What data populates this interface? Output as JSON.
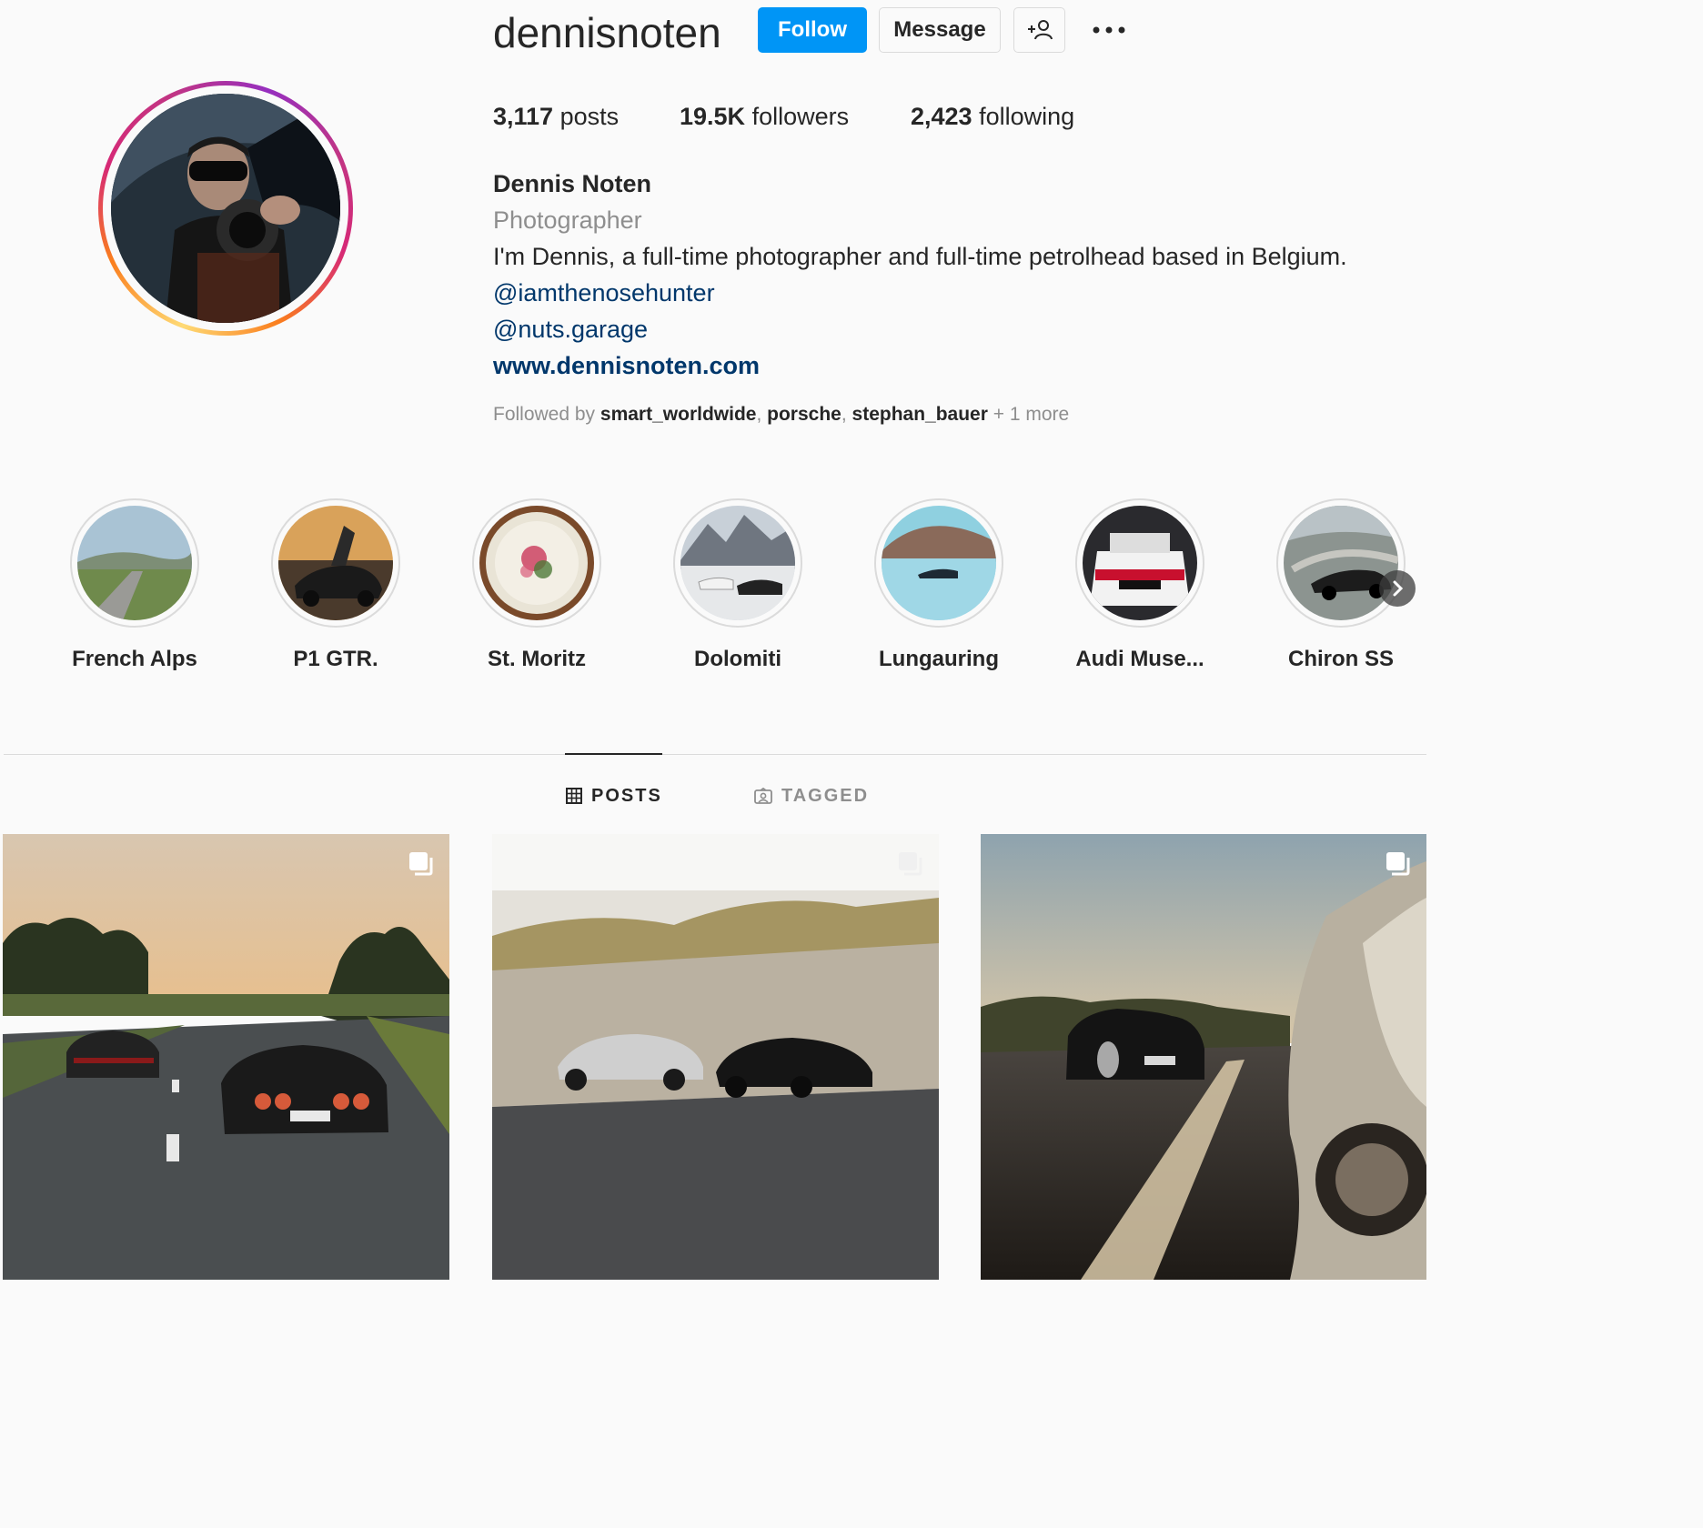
{
  "profile": {
    "username": "dennisnoten",
    "follow_label": "Follow",
    "message_label": "Message",
    "stats": {
      "posts_value": "3,117",
      "posts_label": "posts",
      "followers_value": "19.5K",
      "followers_label": "followers",
      "following_value": "2,423",
      "following_label": "following"
    },
    "full_name": "Dennis Noten",
    "category": "Photographer",
    "bio": "I'm Dennis, a full-time photographer and full-time petrolhead based in Belgium.",
    "mentions": [
      "@iamthenosehunter",
      "@nuts.garage"
    ],
    "website": "www.dennisnoten.com",
    "followed_by": {
      "prefix": "Followed by",
      "accounts": [
        "smart_worldwide",
        "porsche",
        "stephan_bauer"
      ],
      "suffix": "+ 1 more"
    }
  },
  "highlights": [
    {
      "label": "French Alps"
    },
    {
      "label": "P1 GTR."
    },
    {
      "label": "St. Moritz"
    },
    {
      "label": "Dolomiti"
    },
    {
      "label": "Lungauring"
    },
    {
      "label": "Audi Muse..."
    },
    {
      "label": "Chiron SS"
    }
  ],
  "tabs": {
    "posts": "POSTS",
    "tagged": "TAGGED"
  },
  "colors": {
    "follow_blue": "#0095f6",
    "link_blue": "#00376b",
    "muted": "#8e8e8e",
    "text": "#262626",
    "background": "#fafafa"
  },
  "icons": [
    "add-person-icon",
    "more-options-icon",
    "grid-icon",
    "tagged-icon",
    "chevron-right-icon",
    "multiple-photos-icon"
  ]
}
